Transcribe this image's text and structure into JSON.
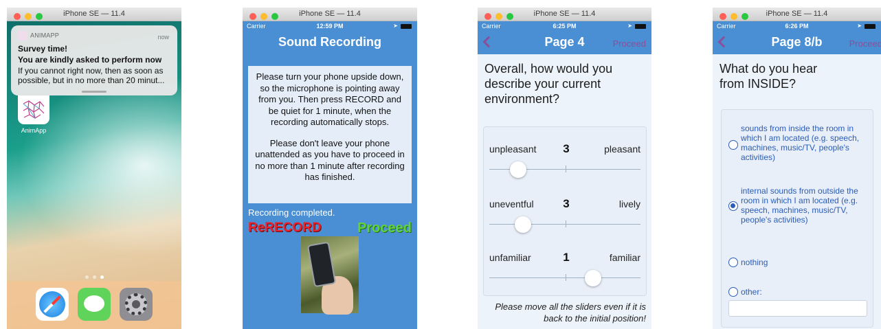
{
  "phone1": {
    "sim_title": "iPhone SE — 11.4",
    "notification": {
      "app": "ANIMAPP",
      "time": "now",
      "title": "Survey time!",
      "subtitle": "You are kindly asked to perform now",
      "body": "If you cannot right now, then as soon as possible, but in no more than 20 minut..."
    },
    "home_app_label": "AnimApp",
    "dock": [
      "safari-icon",
      "messages-icon",
      "settings-icon"
    ]
  },
  "phone2": {
    "sim_title": "iPhone SE — 11.4",
    "carrier": "Carrier",
    "time": "12:59 PM",
    "nav_title": "Sound Recording",
    "instructions_1": "Please turn your phone upside down, so the microphone is pointing away from you. Then press RECORD and be quiet for 1 minute, when the recording automatically stops.",
    "instructions_2": "Please don't leave your phone unattended as you have to proceed in no more than 1 minute after recording has finished.",
    "status": "Recording completed.",
    "rerecord_label": "ReRECORD",
    "proceed_label": "Proceed"
  },
  "phone3": {
    "sim_title": "iPhone SE — 11.4",
    "carrier": "Carrier",
    "time": "6:25 PM",
    "nav_title": "Page 4",
    "proceed_label": "Proceed",
    "question": "Overall, how would you describe your current environment?",
    "sliders": [
      {
        "low": "unpleasant",
        "value": "3",
        "high": "pleasant",
        "position": 0.19
      },
      {
        "low": "uneventful",
        "value": "3",
        "high": "lively",
        "position": 0.22
      },
      {
        "low": "unfamiliar",
        "value": "1",
        "high": "familiar",
        "position": 0.68
      }
    ],
    "hint": "Please move all the sliders even if it is back to the initial position!"
  },
  "phone4": {
    "sim_title": "iPhone SE — 11.4",
    "carrier": "Carrier",
    "time": "6:26 PM",
    "nav_title": "Page 8/b",
    "proceed_label": "Proceed",
    "question": "What do you hear from INSIDE?",
    "options": [
      {
        "text": "sounds from inside the room in which I am located (e.g. speech, machines, music/TV, people's activities)",
        "selected": false
      },
      {
        "text": "internal sounds from outside the room in which I am located (e.g. speech, machines, music/TV, people's activities)",
        "selected": true
      },
      {
        "text": "nothing",
        "selected": false
      },
      {
        "text": "other:",
        "selected": false
      }
    ],
    "other_value": ""
  },
  "colors": {
    "nav_blue": "#4a8fd3",
    "accent_purple": "#8a4f9a",
    "rerecord_red": "#e8232b",
    "proceed_green": "#5fd23f",
    "option_blue": "#2a5cb8"
  }
}
